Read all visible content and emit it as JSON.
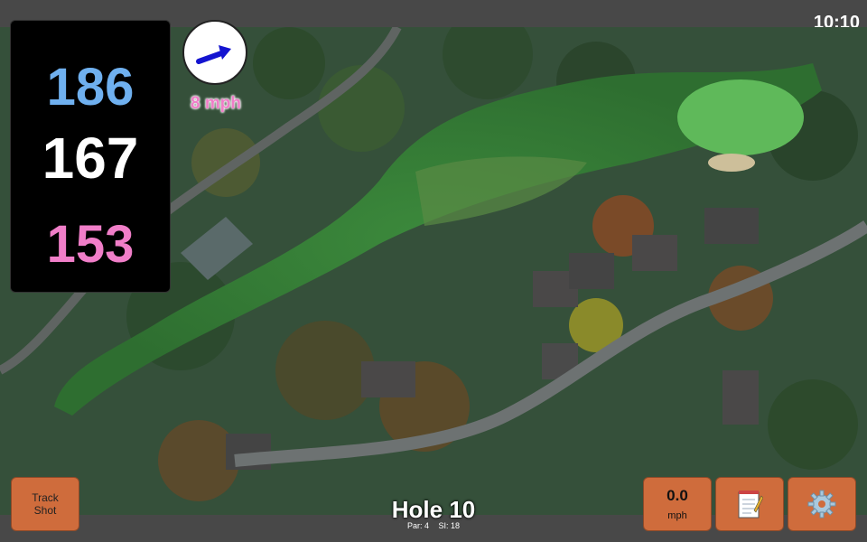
{
  "status": {
    "time": "10:10"
  },
  "distances": {
    "back": "186",
    "middle": "167",
    "front": "153"
  },
  "wind": {
    "speed": "8 mph",
    "icon": "wind-direction-arrow-icon"
  },
  "buttons": {
    "track_shot_line1": "Track",
    "track_shot_line2": "Shot",
    "speed_value": "0.0",
    "speed_unit": "mph",
    "notes_icon": "notepad-icon",
    "settings_icon": "gear-icon"
  },
  "hole": {
    "title": "Hole 10",
    "par": "Par: 4",
    "si": "SI: 18"
  },
  "colors": {
    "back": "#6fb0ef",
    "middle": "#ffffff",
    "front": "#f07ec8",
    "button": "#cf6c3c"
  }
}
